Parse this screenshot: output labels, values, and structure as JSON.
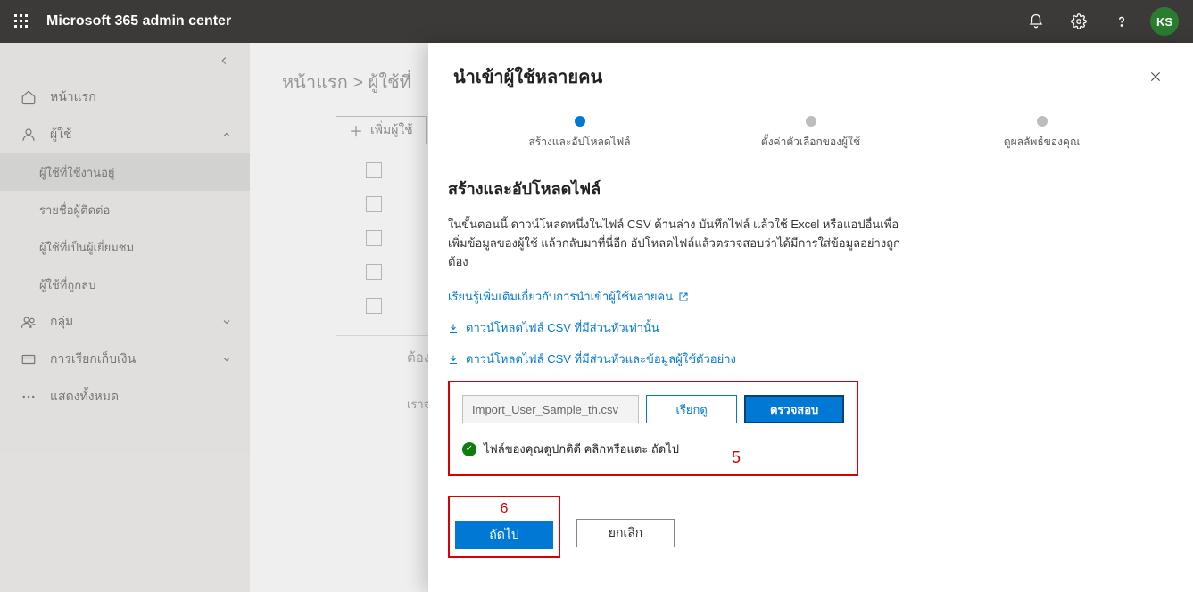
{
  "header": {
    "app_title": "Microsoft 365 admin center",
    "avatar_initials": "KS"
  },
  "sidebar": {
    "home": "หน้าแรก",
    "users": "ผู้ใช้",
    "users_sub": {
      "active": "ผู้ใช้ที่ใช้งานอยู่",
      "contacts": "รายชื่อผู้ติดต่อ",
      "guest": "ผู้ใช้ที่เป็นผู้เยี่ยมชม",
      "deleted": "ผู้ใช้ที่ถูกลบ"
    },
    "groups": "กลุ่ม",
    "billing": "การเรียกเก็บเงิน",
    "show_all": "แสดงทั้งหมด"
  },
  "main": {
    "breadcrumb_home": "หน้าแรก",
    "breadcrumb_sep": " > ",
    "breadcrumb_current": "ผู้ใช้ที่",
    "add_user": "เพิ่มผู้ใช้",
    "need_heading": "ต้องก",
    "help_line": "เราจะช่วยคุ"
  },
  "panel": {
    "title": "นำเข้าผู้ใช้หลายคน",
    "steps": {
      "s1": "สร้างและอัปโหลดไฟล์",
      "s2": "ตั้งค่าตัวเลือกของผู้ใช้",
      "s3": "ดูผลลัพธ์ของคุณ"
    },
    "section_title": "สร้างและอัปโหลดไฟล์",
    "section_desc": "ในขั้นตอนนี้ ดาวน์โหลดหนึ่งในไฟล์ CSV ด้านล่าง บันทึกไฟล์ แล้วใช้ Excel หรือแอปอื่นเพื่อเพิ่มข้อมูลของผู้ใช้ แล้วกลับมาที่นี่อีก อัปโหลดไฟล์แล้วตรวจสอบว่าได้มีการใส่ข้อมูลอย่างถูกต้อง",
    "learn_more": "เรียนรู้เพิ่มเติมเกี่ยวกับการนำเข้าผู้ใช้หลายคน",
    "dl_headers": "ดาวน์โหลดไฟล์ CSV ที่มีส่วนหัวเท่านั้น",
    "dl_sample": "ดาวน์โหลดไฟล์ CSV ที่มีส่วนหัวและข้อมูลผู้ใช้ตัวอย่าง",
    "file_name": "Import_User_Sample_th.csv",
    "browse": "เรียกดู",
    "verify": "ตรวจสอบ",
    "status_ok": "ไฟล์ของคุณดูปกติดี คลิกหรือแตะ ถัดไป",
    "anno5": "5",
    "anno6": "6",
    "next": "ถัดไป",
    "cancel": "ยกเลิก"
  }
}
